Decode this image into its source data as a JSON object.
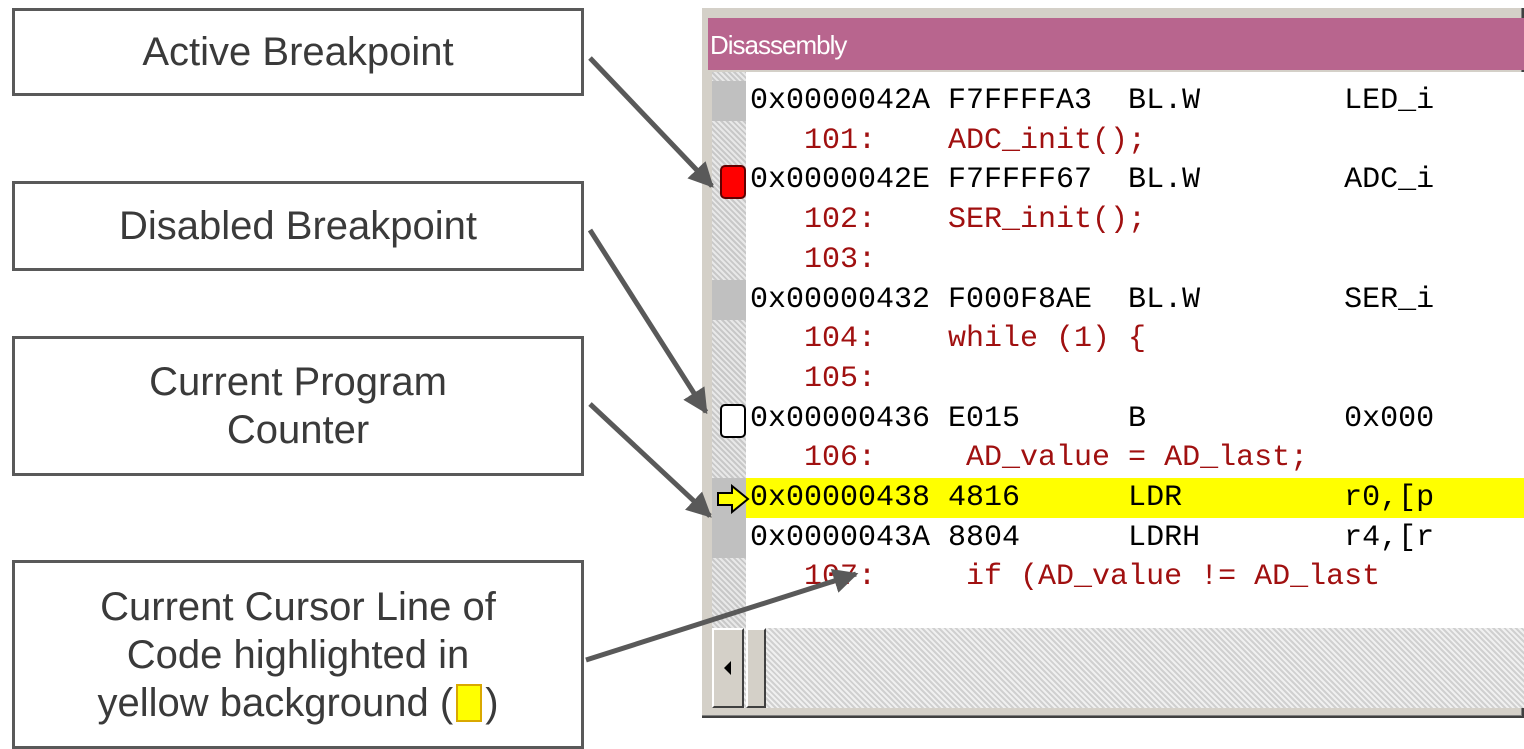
{
  "callouts": {
    "active_breakpoint": "Active Breakpoint",
    "disabled_breakpoint": "Disabled Breakpoint",
    "current_pc": "Current Program\nCounter",
    "cursor_line_pre": "Current Cursor Line of\nCode highlighted in\nyellow background (",
    "cursor_line_post": ")"
  },
  "window": {
    "title": "Disassembly"
  },
  "lines": [
    {
      "kind": "asm",
      "text": "0x0000042A F7FFFFA3  BL.W        LED_i",
      "gutter": "solid"
    },
    {
      "kind": "src",
      "text": "   101:    ADC_init();",
      "gutter": "hatch"
    },
    {
      "kind": "asm",
      "text": "0x0000042E F7FFFF67  BL.W        ADC_i",
      "gutter": "bp-active"
    },
    {
      "kind": "src",
      "text": "   102:    SER_init();",
      "gutter": "hatch"
    },
    {
      "kind": "src",
      "text": "   103:",
      "gutter": "hatch"
    },
    {
      "kind": "asm",
      "text": "0x00000432 F000F8AE  BL.W        SER_i",
      "gutter": "solid"
    },
    {
      "kind": "src",
      "text": "   104:    while (1) {",
      "gutter": "hatch"
    },
    {
      "kind": "src",
      "text": "   105:",
      "gutter": "hatch"
    },
    {
      "kind": "asm",
      "text": "0x00000436 E015      B           0x000",
      "gutter": "bp-disabled"
    },
    {
      "kind": "src",
      "text": "   106:     AD_value = AD_last;",
      "gutter": "hatch"
    },
    {
      "kind": "asm",
      "text": "0x00000438 4816      LDR         r0,[p",
      "gutter": "pc",
      "highlight": true
    },
    {
      "kind": "asm",
      "text": "0x0000043A 8804      LDRH        r4,[r",
      "gutter": "solid"
    },
    {
      "kind": "src",
      "text": "   107:     if (AD_value != AD_last",
      "gutter": "hatch"
    }
  ],
  "colors": {
    "titlebar": "#b8658e",
    "highlight": "#ffff00",
    "active_breakpoint": "#ff0000",
    "source_text": "#a01010"
  }
}
